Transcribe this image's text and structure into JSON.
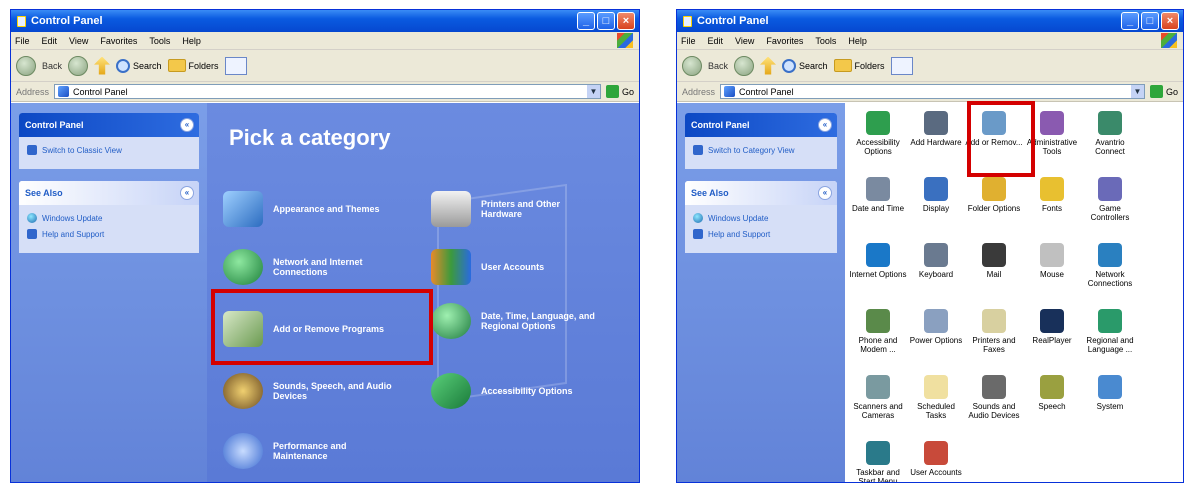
{
  "left_window": {
    "title": "Control Panel",
    "menu": [
      "File",
      "Edit",
      "View",
      "Favorites",
      "Tools",
      "Help"
    ],
    "toolbar": {
      "back": "Back",
      "search": "Search",
      "folders": "Folders"
    },
    "address": {
      "label": "Address",
      "value": "Control Panel",
      "go": "Go"
    },
    "side": {
      "cp_title": "Control Panel",
      "switch_view": "Switch to Classic View",
      "see_also": "See Also",
      "see_also_items": [
        "Windows Update",
        "Help and Support"
      ]
    },
    "heading": "Pick a category",
    "categories": [
      {
        "label": "Appearance and Themes",
        "icon": "appearance-icon"
      },
      {
        "label": "Printers and Other Hardware",
        "icon": "printer-icon"
      },
      {
        "label": "Network and Internet Connections",
        "icon": "network-icon"
      },
      {
        "label": "User Accounts",
        "icon": "users-icon"
      },
      {
        "label": "Add or Remove Programs",
        "icon": "add-remove-programs-icon"
      },
      {
        "label": "Date, Time, Language, and Regional Options",
        "icon": "globe-clock-icon"
      },
      {
        "label": "Sounds, Speech, and Audio Devices",
        "icon": "speaker-icon"
      },
      {
        "label": "Accessibility Options",
        "icon": "accessibility-icon"
      },
      {
        "label": "Performance and Maintenance",
        "icon": "performance-icon"
      }
    ]
  },
  "right_window": {
    "title": "Control Panel",
    "menu": [
      "File",
      "Edit",
      "View",
      "Favorites",
      "Tools",
      "Help"
    ],
    "toolbar": {
      "back": "Back",
      "search": "Search",
      "folders": "Folders"
    },
    "address": {
      "label": "Address",
      "value": "Control Panel",
      "go": "Go"
    },
    "side": {
      "cp_title": "Control Panel",
      "switch_view": "Switch to Category View",
      "see_also": "See Also",
      "see_also_items": [
        "Windows Update",
        "Help and Support"
      ]
    },
    "items": [
      {
        "label": "Accessibility Options",
        "icon": "accessibility-icon"
      },
      {
        "label": "Add Hardware",
        "icon": "hardware-icon"
      },
      {
        "label": "Add or Remov...",
        "icon": "add-remove-programs-icon"
      },
      {
        "label": "Administrative Tools",
        "icon": "admin-tools-icon"
      },
      {
        "label": "Avantrio Connect",
        "icon": "connect-icon"
      },
      {
        "label": "Date and Time",
        "icon": "clock-icon"
      },
      {
        "label": "Display",
        "icon": "display-icon"
      },
      {
        "label": "Folder Options",
        "icon": "folder-icon"
      },
      {
        "label": "Fonts",
        "icon": "fonts-icon"
      },
      {
        "label": "Game Controllers",
        "icon": "gamepad-icon"
      },
      {
        "label": "Internet Options",
        "icon": "globe-icon"
      },
      {
        "label": "Keyboard",
        "icon": "keyboard-icon"
      },
      {
        "label": "Mail",
        "icon": "mail-icon"
      },
      {
        "label": "Mouse",
        "icon": "mouse-icon"
      },
      {
        "label": "Network Connections",
        "icon": "network-icon"
      },
      {
        "label": "Phone and Modem ...",
        "icon": "phone-icon"
      },
      {
        "label": "Power Options",
        "icon": "power-icon"
      },
      {
        "label": "Printers and Faxes",
        "icon": "printer-icon"
      },
      {
        "label": "RealPlayer",
        "icon": "realplayer-icon"
      },
      {
        "label": "Regional and Language ...",
        "icon": "regional-icon"
      },
      {
        "label": "Scanners and Cameras",
        "icon": "scanner-icon"
      },
      {
        "label": "Scheduled Tasks",
        "icon": "scheduled-tasks-icon"
      },
      {
        "label": "Sounds and Audio Devices",
        "icon": "speaker-icon"
      },
      {
        "label": "Speech",
        "icon": "speech-icon"
      },
      {
        "label": "System",
        "icon": "system-icon"
      },
      {
        "label": "Taskbar and Start Menu",
        "icon": "taskbar-icon"
      },
      {
        "label": "User Accounts",
        "icon": "users-icon"
      }
    ]
  },
  "colors": {
    "highlight": "#d40000",
    "xp_blue": "#0a5ae0",
    "panel_blue": "#6b8be0"
  }
}
